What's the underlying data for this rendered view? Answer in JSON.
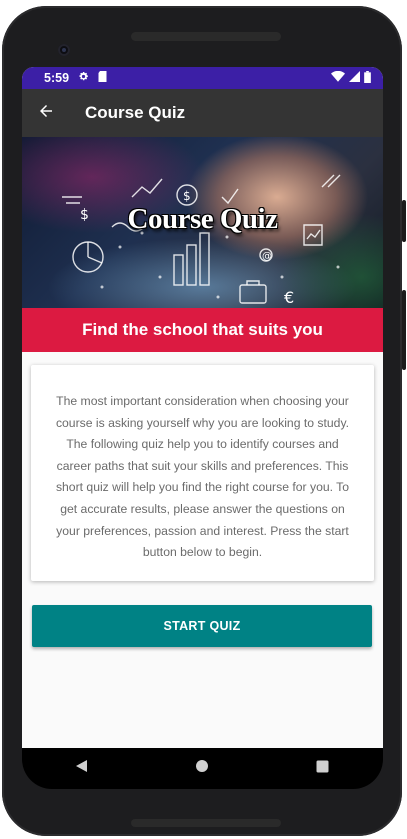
{
  "status_bar": {
    "time": "5:59",
    "icons": [
      "gear-icon",
      "sd-card-icon",
      "wifi-icon",
      "signal-icon",
      "battery-icon"
    ]
  },
  "app_bar": {
    "title": "Course Quiz",
    "back_icon": "arrow-back-icon"
  },
  "banner": {
    "title": "Course Quiz"
  },
  "tagline": "Find the school that suits you",
  "intro_text": "The most important consideration when choosing your course is asking yourself why you are looking to study. The following quiz help you to identify courses and career paths that suit your skills and preferences. This short quiz will help you find the right course for you. To get accurate results, please answer the questions on your preferences, passion and interest. Press the start button below to begin.",
  "start_button": "START QUIZ",
  "nav_bar": {
    "icons": [
      "back-triangle-icon",
      "home-circle-icon",
      "recents-square-icon"
    ]
  },
  "colors": {
    "status_bar": "#3c1fa6",
    "app_bar": "#343434",
    "tagline_bar": "#dc1a41",
    "button": "#008285",
    "background": "#fafafa"
  }
}
